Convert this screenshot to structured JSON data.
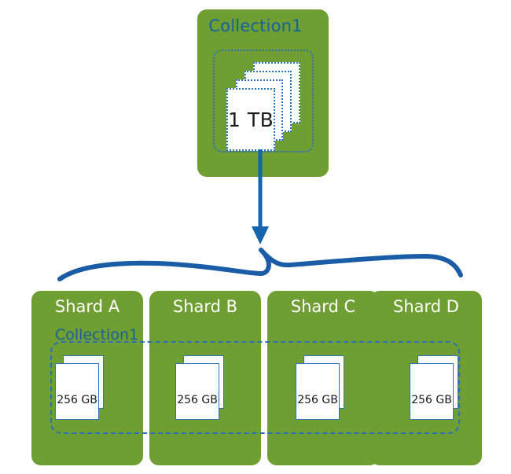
{
  "diagram": {
    "title": "MongoDB collection sharding diagram",
    "colors": {
      "green": "#6f9e33",
      "blue": "#17609f",
      "document_border": "#2f73b8",
      "dotted_border": "#2b6fb5",
      "white": "#ffffff",
      "text_dark": "#1a1a1a"
    }
  },
  "source": {
    "box_label": "Collection1",
    "document_size": "1 TB",
    "document_count": 4
  },
  "arrow": {
    "name": "split-arrow",
    "direction": "down"
  },
  "brace": {
    "name": "curly-brace",
    "orientation": "up"
  },
  "shards": {
    "collection_label": "Collection1",
    "items": [
      {
        "label": "Shard A",
        "document_size": "256 GB",
        "document_count": 2
      },
      {
        "label": "Shard B",
        "document_size": "256 GB",
        "document_count": 2
      },
      {
        "label": "Shard C",
        "document_size": "256 GB",
        "document_count": 2
      },
      {
        "label": "Shard D",
        "document_size": "256 GB",
        "document_count": 2
      }
    ]
  }
}
